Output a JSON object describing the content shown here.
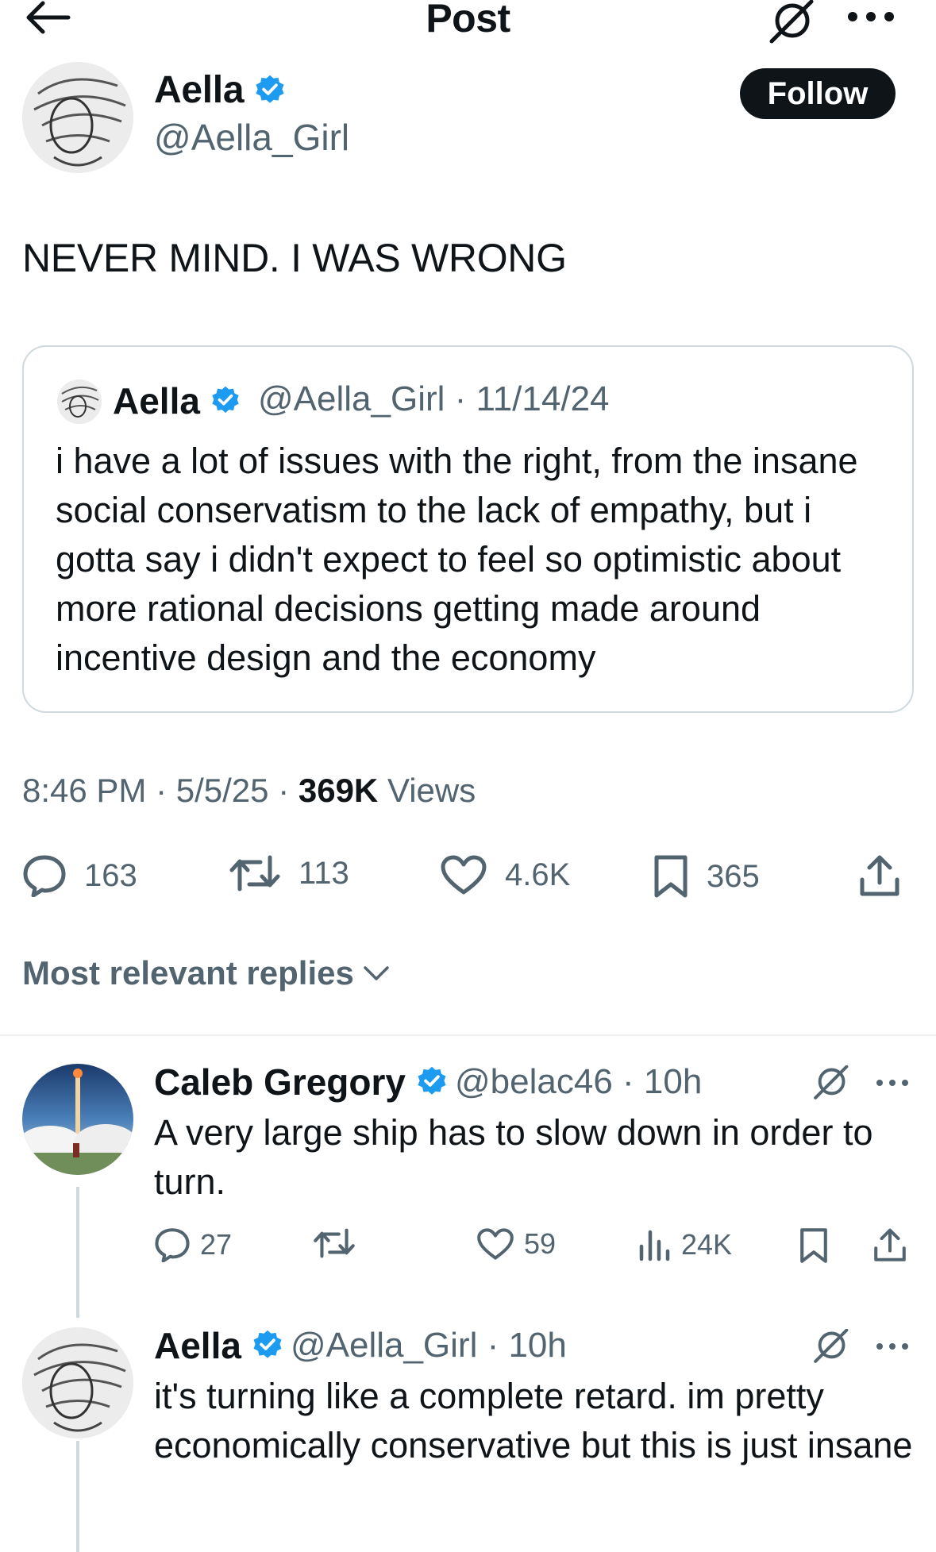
{
  "header": {
    "title": "Post"
  },
  "author": {
    "name": "Aella",
    "handle": "@Aella_Girl",
    "follow_label": "Follow"
  },
  "tweet": {
    "text": "NEVER MIND. I WAS WRONG",
    "time": "8:46 PM",
    "date": "5/5/25",
    "views_count": "369K",
    "views_label": "Views",
    "replies": "163",
    "retweets": "113",
    "likes": "4.6K",
    "bookmarks": "365"
  },
  "quote": {
    "name": "Aella",
    "handle_date": "@Aella_Girl · 11/14/24",
    "text": "i have a lot of issues with the right, from the insane social conservatism to the lack of empathy, but i gotta say i didn't expect to feel so optimistic about more rational decisions getting made around incentive design and the economy"
  },
  "sort_label": "Most relevant replies",
  "replies": [
    {
      "name": "Caleb Gregory",
      "handle_time": "@belac46 · 10h",
      "text": "A very large ship has to slow down in order to turn.",
      "reply_count": "27",
      "like_count": "59",
      "view_count": "24K"
    },
    {
      "name": "Aella",
      "handle_time": "@Aella_Girl · 10h",
      "text": "it's turning like a complete retard. im pretty economically conservative but this is just insane"
    }
  ],
  "colors": {
    "text": "#0f1419",
    "secondary": "#536471",
    "verified": "#1d9bf0",
    "border": "#cfd9de"
  },
  "icons": [
    "back-arrow-icon",
    "grok-icon",
    "more-icon",
    "verified-icon",
    "reply-icon",
    "retweet-icon",
    "like-icon",
    "bookmark-icon",
    "share-icon",
    "views-icon",
    "chevron-down-icon"
  ]
}
